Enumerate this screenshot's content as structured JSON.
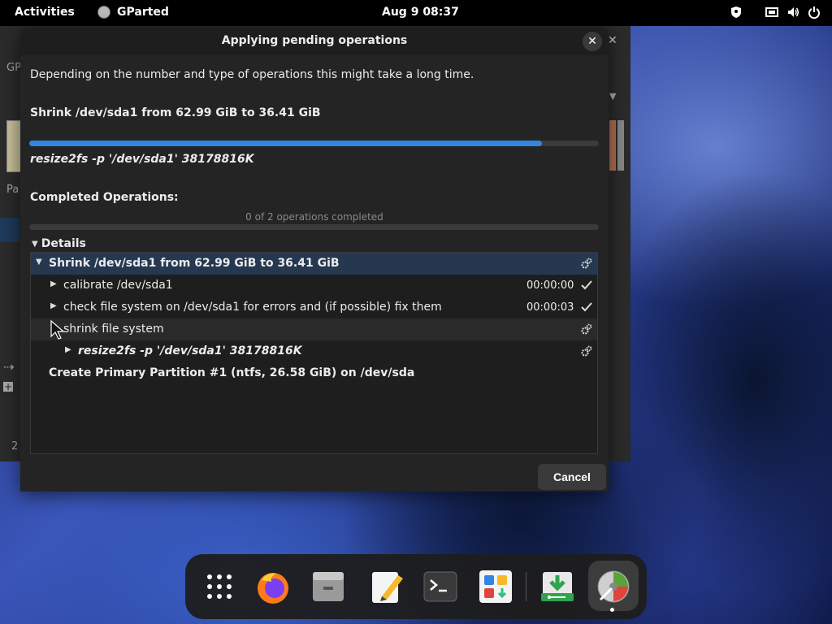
{
  "topbar": {
    "activities": "Activities",
    "app_name": "GParted",
    "clock": "Aug 9  08:37"
  },
  "background_window": {
    "frag_title": "GP",
    "frag_pa": "Pa",
    "frag_2": "2"
  },
  "dialog": {
    "title": "Applying pending operations",
    "description": "Depending on the number and type of operations this might take a long time.",
    "current_operation": "Shrink /dev/sda1 from 62.99 GiB to 36.41 GiB",
    "current_progress_fraction": 0.9,
    "current_command": "resize2fs -p '/dev/sda1' 38178816K",
    "completed_label": "Completed Operations:",
    "completed_status": "0 of 2 operations completed",
    "completed_progress_fraction": 0,
    "details_label": "Details",
    "cancel_label": "Cancel"
  },
  "details": {
    "rows": [
      {
        "label": "Shrink /dev/sda1 from 62.99 GiB to 36.41 GiB",
        "time": "",
        "status": "running"
      },
      {
        "label": "calibrate /dev/sda1",
        "time": "00:00:00",
        "status": "success"
      },
      {
        "label": "check file system on /dev/sda1 for errors and (if possible) fix them",
        "time": "00:00:03",
        "status": "success"
      },
      {
        "label": "shrink file system",
        "time": "",
        "status": "running"
      },
      {
        "label": "resize2fs -p '/dev/sda1' 38178816K",
        "time": "",
        "status": "running"
      },
      {
        "label": "Create Primary Partition #1 (ntfs, 26.58 GiB) on /dev/sda",
        "time": "",
        "status": ""
      }
    ]
  },
  "dock": {
    "apps": [
      "app-grid-icon",
      "firefox-icon",
      "files-icon",
      "text-editor-icon",
      "terminal-icon",
      "software-icon",
      "installer-icon",
      "gparted-icon"
    ]
  }
}
